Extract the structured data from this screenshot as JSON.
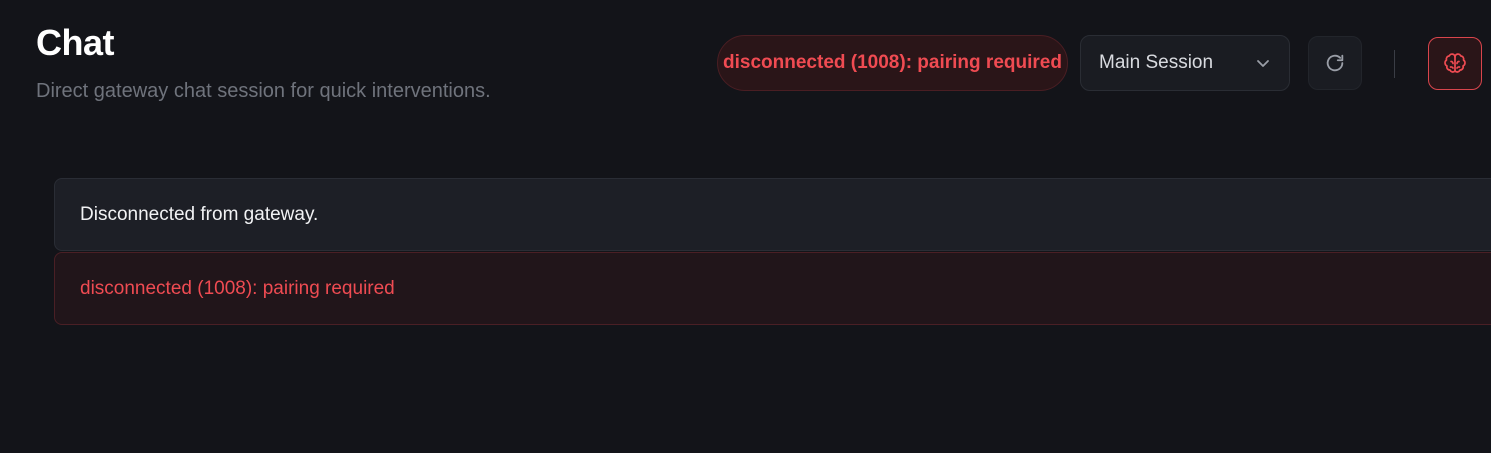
{
  "header": {
    "title": "Chat",
    "subtitle": "Direct gateway chat session for quick interventions."
  },
  "toolbar": {
    "status_text": "disconnected (1008): pairing required",
    "session_selected": "Main Session",
    "refresh_icon": "refresh-icon",
    "focus_icon": "brain-icon"
  },
  "messages": [
    {
      "type": "info",
      "text": "Disconnected from gateway."
    },
    {
      "type": "error",
      "text": "disconnected (1008): pairing required"
    }
  ],
  "colors": {
    "background": "#131419",
    "error": "#ef4b52",
    "muted": "#6f737c"
  }
}
